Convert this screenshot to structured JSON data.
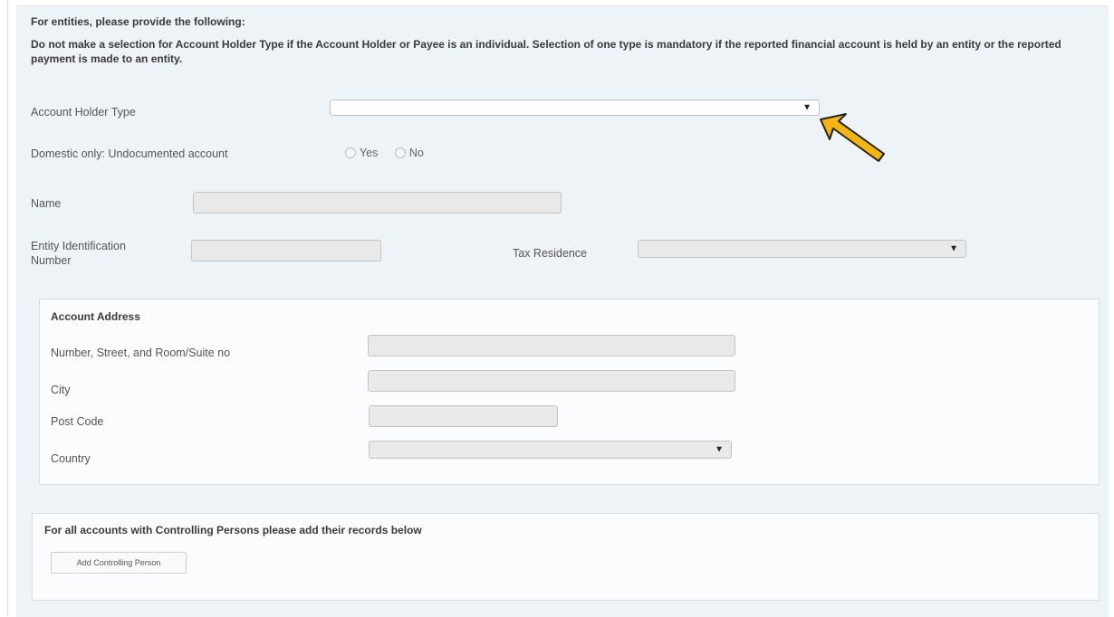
{
  "form": {
    "entities_header": "For entities, please provide the following:",
    "entities_note": "Do not make a selection for Account Holder Type if the Account Holder or Payee is an individual. Selection of one type is mandatory if the reported financial account is held by an entity or the reported payment is made to an entity.",
    "account_holder_type": {
      "label": "Account Holder Type",
      "value": ""
    },
    "undocumented": {
      "label": "Domestic only: Undocumented account",
      "yes": "Yes",
      "no": "No"
    },
    "name": {
      "label": "Name",
      "value": ""
    },
    "entity_id": {
      "label_line1": "Entity Identification",
      "label_line2": "Number",
      "value": ""
    },
    "tax_residence": {
      "label": "Tax Residence",
      "value": ""
    }
  },
  "address": {
    "title": "Account Address",
    "street_label": "Number, Street, and Room/Suite no",
    "city_label": "City",
    "post_code_label": "Post Code",
    "country_label": "Country"
  },
  "controlling": {
    "header": "For all accounts with Controlling Persons please add their records below",
    "add_button": "Add Controlling Person"
  },
  "icons": {
    "dropdown": "▼",
    "annotation": "arrow-pointer-icon"
  },
  "colors": {
    "panel": "#eef3f7",
    "arrow_fill": "#f6b40e",
    "arrow_stroke": "#222222"
  }
}
